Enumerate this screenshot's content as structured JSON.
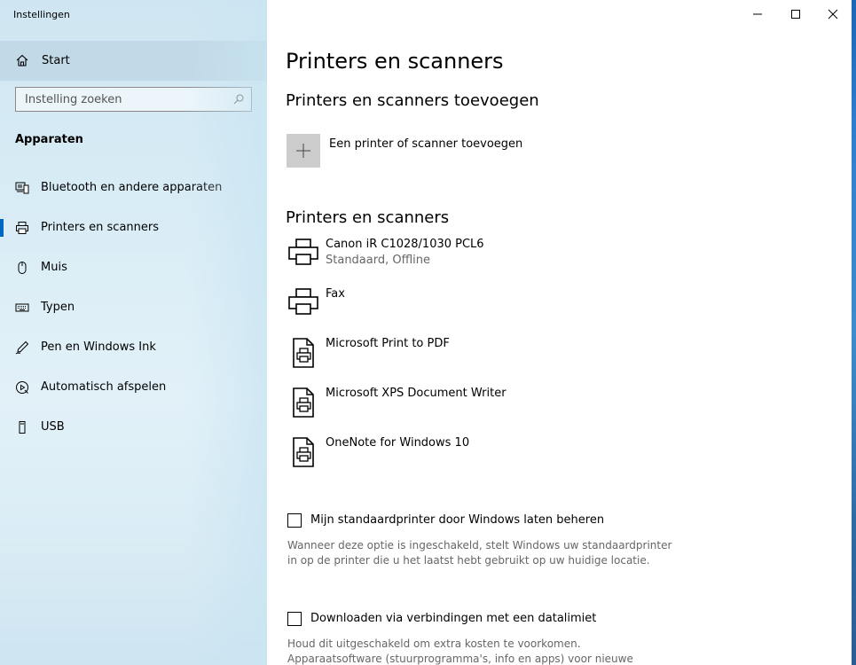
{
  "window": {
    "title": "Instellingen",
    "controls": {
      "minimize": "–",
      "maximize": "□",
      "close": "✕"
    }
  },
  "sidebar": {
    "home_label": "Start",
    "search_placeholder": "Instelling zoeken",
    "section_title": "Apparaten",
    "items": [
      {
        "label": "Bluetooth en andere apparaten",
        "icon": "bluetooth-devices-icon"
      },
      {
        "label": "Printers en scanners",
        "icon": "printer-icon",
        "active": true
      },
      {
        "label": "Muis",
        "icon": "mouse-icon"
      },
      {
        "label": "Typen",
        "icon": "keyboard-icon"
      },
      {
        "label": "Pen en Windows Ink",
        "icon": "pen-icon"
      },
      {
        "label": "Automatisch afspelen",
        "icon": "autoplay-icon"
      },
      {
        "label": "USB",
        "icon": "usb-icon"
      }
    ]
  },
  "main": {
    "page_title": "Printers en scanners",
    "add_section_title": "Printers en scanners toevoegen",
    "add_button_label": "Een printer of scanner toevoegen",
    "list_section_title": "Printers en scanners",
    "devices": [
      {
        "name": "Canon iR C1028/1030 PCL6",
        "status": "Standaard, Offline",
        "icon": "printer-icon"
      },
      {
        "name": "Fax",
        "status": "",
        "icon": "printer-icon"
      },
      {
        "name": "Microsoft Print to PDF",
        "status": "",
        "icon": "document-printer-icon"
      },
      {
        "name": "Microsoft XPS Document Writer",
        "status": "",
        "icon": "document-printer-icon"
      },
      {
        "name": "OneNote for Windows 10",
        "status": "",
        "icon": "document-printer-icon"
      }
    ],
    "options": [
      {
        "label": "Mijn standaardprinter door Windows laten beheren",
        "checked": false,
        "description_lines": [
          "Wanneer deze optie is ingeschakeld, stelt Windows uw standaardprinter",
          "in op de printer die u het laatst hebt gebruikt op uw huidige locatie."
        ]
      },
      {
        "label": "Downloaden via verbindingen met een datalimiet",
        "checked": false,
        "description_lines": [
          "Houd dit uitgeschakeld om extra kosten te voorkomen.",
          "Apparaatsoftware (stuurprogramma's, info en apps) voor nieuwe"
        ]
      }
    ]
  },
  "colors": {
    "accent": "#0067c0",
    "sidebar_bg": "#d8ecf5",
    "tile_gray": "#cccccc",
    "secondary_text": "#666666"
  }
}
